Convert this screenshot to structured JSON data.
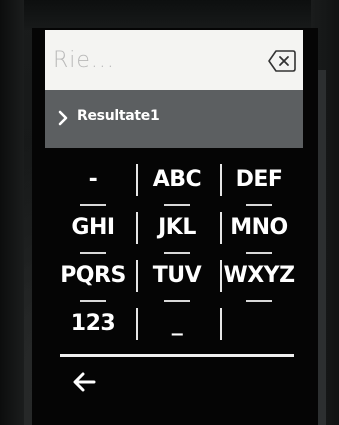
{
  "search": {
    "placeholder": "Rie...",
    "value": "",
    "clear_icon": "backspace-x-icon"
  },
  "result": {
    "label": "Resultate1",
    "chevron_icon": "chevron-right-icon"
  },
  "keypad": {
    "keys": [
      {
        "label": "-"
      },
      {
        "label": "ABC"
      },
      {
        "label": "DEF"
      },
      {
        "label": "GHI"
      },
      {
        "label": "JKL"
      },
      {
        "label": "MNO"
      },
      {
        "label": "PQRS"
      },
      {
        "label": "TUV"
      },
      {
        "label": "WXYZ"
      },
      {
        "label": "123"
      },
      {
        "label": "_"
      },
      {
        "label": ""
      }
    ]
  },
  "nav": {
    "back_icon": "back-arrow-icon"
  },
  "colors": {
    "screen_bg": "#050505",
    "search_bg": "#f4f4f2",
    "result_bg": "#5c5f61",
    "key_text": "#ffffff"
  }
}
